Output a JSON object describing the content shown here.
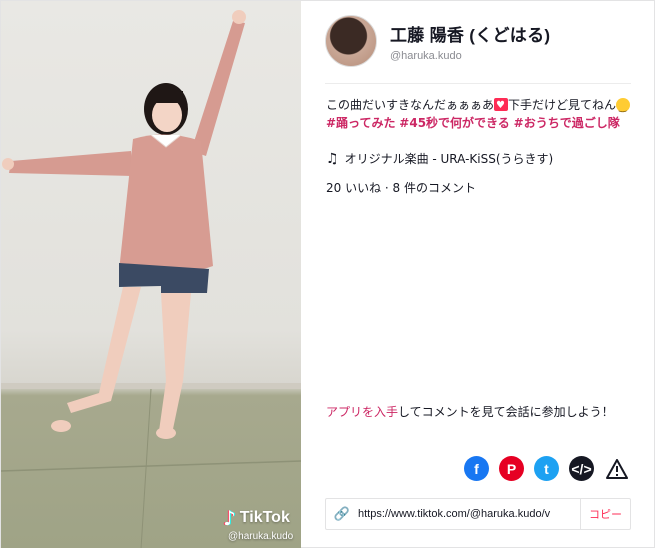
{
  "author": {
    "name": "工藤 陽香 (くどはる)",
    "handle": "@haruka.kudo",
    "avatar_icon": "user-avatar"
  },
  "caption": {
    "text1": "この曲だいすきなんだぁぁぁあ",
    "emoji1": "heart-emoji",
    "text2": "下手だけど見てねん",
    "emoji2": "smile-emoji",
    "tags": [
      "#踊ってみた",
      "#45秒で何ができる",
      "#おうちで過ごし隊"
    ]
  },
  "music": {
    "icon": "music-note-icon",
    "label": "オリジナル楽曲 - URA-KiSS(うらきす)"
  },
  "stats": "20 いいね · 8 件のコメント",
  "cta": {
    "link": "アプリを入手",
    "rest": "してコメントを見て会話に参加しよう！"
  },
  "share": {
    "facebook": "f",
    "pinterest": "P",
    "twitter": "t",
    "embed": "</>",
    "report": "!"
  },
  "link_box": {
    "icon": "link-icon",
    "url": "https://www.tiktok.com/@haruka.kudo/v",
    "copy_label": "コピー"
  },
  "video": {
    "watermark_logo": "TikTok",
    "watermark_user": "@haruka.kudo",
    "colors": {
      "sweater": "#d79c92",
      "floor": "#a3a689",
      "wall": "#e8e7e3"
    }
  }
}
